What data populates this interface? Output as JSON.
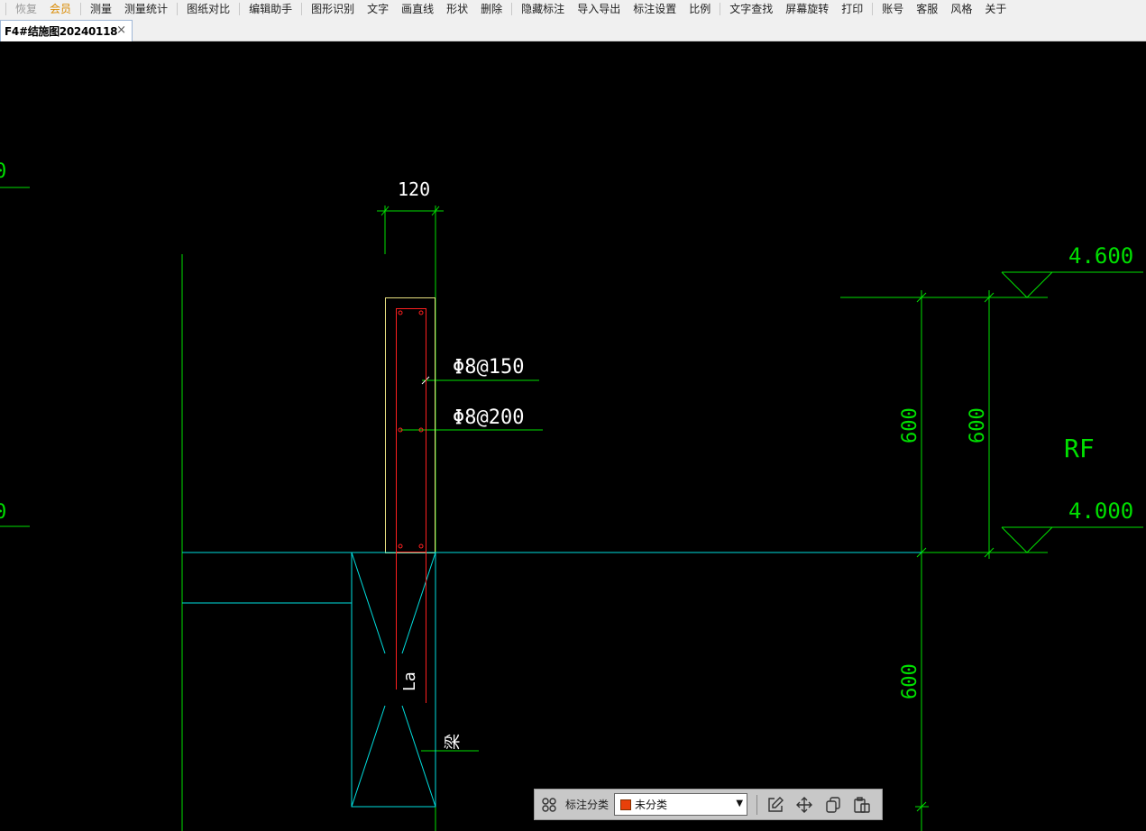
{
  "menu": {
    "items": [
      {
        "label": "恢复",
        "state": "disabled"
      },
      {
        "label": "会员",
        "state": "accent"
      },
      {
        "label": "测量",
        "state": "normal"
      },
      {
        "label": "测量统计",
        "state": "normal"
      },
      {
        "label": "图纸对比",
        "state": "normal"
      },
      {
        "label": "编辑助手",
        "state": "normal"
      },
      {
        "label": "图形识别",
        "state": "normal"
      },
      {
        "label": "文字",
        "state": "normal"
      },
      {
        "label": "画直线",
        "state": "normal"
      },
      {
        "label": "形状",
        "state": "normal"
      },
      {
        "label": "删除",
        "state": "normal"
      },
      {
        "label": "隐藏标注",
        "state": "normal"
      },
      {
        "label": "导入导出",
        "state": "normal"
      },
      {
        "label": "标注设置",
        "state": "normal"
      },
      {
        "label": "比例",
        "state": "normal"
      },
      {
        "label": "文字查找",
        "state": "normal"
      },
      {
        "label": "屏幕旋转",
        "state": "normal"
      },
      {
        "label": "打印",
        "state": "normal"
      },
      {
        "label": "账号",
        "state": "normal"
      },
      {
        "label": "客服",
        "state": "normal"
      },
      {
        "label": "风格",
        "state": "normal"
      },
      {
        "label": "关于",
        "state": "normal"
      }
    ]
  },
  "tab": {
    "title": "F4#结施图20240118",
    "close": "×"
  },
  "drawing": {
    "dim_top": "120",
    "rebar_1": "Φ8@150",
    "rebar_2": "Φ8@200",
    "elev_top": "4.600",
    "elev_bottom": "4.000",
    "dim_600_a": "600",
    "dim_600_b": "600",
    "dim_600_c": "600",
    "level_label": "RF",
    "anchor_label": "La",
    "beam_label": "梁",
    "edge_label_top": "0",
    "edge_label_bottom": "0",
    "colors": {
      "green": "#00e000",
      "cyan": "#00e0e0",
      "red": "#ff2020",
      "yellow": "#e8e080",
      "white": "#ffffff"
    }
  },
  "annotation_toolbar": {
    "label": "标注分类",
    "category": "未分类",
    "category_color": "#e8400a",
    "icons": [
      "grid-icon",
      "edit-icon",
      "move-icon",
      "copy-icon",
      "paste-icon"
    ]
  }
}
